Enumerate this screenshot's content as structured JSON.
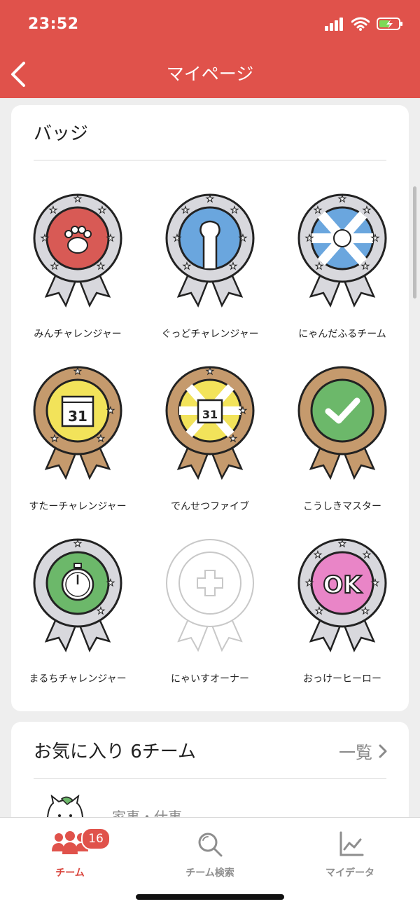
{
  "status": {
    "time": "23:52"
  },
  "header": {
    "title": "マイページ"
  },
  "badges_section": {
    "title": "バッジ",
    "badges": [
      {
        "label": "みんチャレンジャー"
      },
      {
        "label": "ぐっどチャレンジャー"
      },
      {
        "label": "にゃんだふるチーム"
      },
      {
        "label": "すたーチャレンジャー"
      },
      {
        "label": "でんせつファイブ"
      },
      {
        "label": "こうしきマスター"
      },
      {
        "label": "まるちチャレンジャー"
      },
      {
        "label": "にゃいすオーナー"
      },
      {
        "label": "おっけーヒーロー"
      }
    ],
    "calendar_number": "31",
    "ok_text": "OK"
  },
  "favorites": {
    "title": "お気に入り 6チーム",
    "link": "一覧",
    "first_team_category": "家事・仕事"
  },
  "tabs": [
    {
      "label": "チーム",
      "badge": "16"
    },
    {
      "label": "チーム検索"
    },
    {
      "label": "マイデータ"
    }
  ],
  "colors": {
    "header": "#e0524b",
    "active_tab": "#d9453d"
  }
}
